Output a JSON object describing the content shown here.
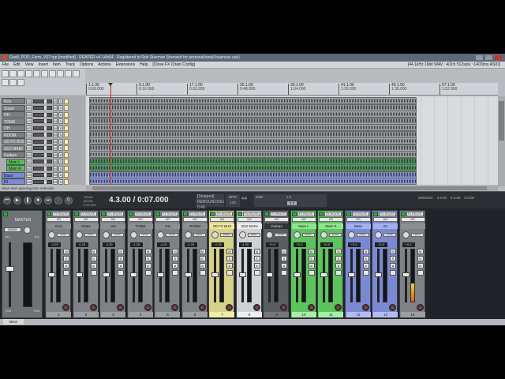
{
  "window": {
    "title": "Grw8_POD_Farm_VST.rpp [modified] - REAPER v4.14/x64 - Registered to Rob Siseman (licensed for personal/small business use)"
  },
  "menu": {
    "items": [
      "File",
      "Edit",
      "View",
      "Insert",
      "Item",
      "Track",
      "Options",
      "Actions",
      "Extensions",
      "Help",
      "[Close FX Chain Config]"
    ],
    "audio_format": "[44.1kHz 16bit WAV : 4/2ch 512spls ~14/29ms ASIO]"
  },
  "ruler": {
    "ticks": [
      {
        "bar": "1.1.00",
        "time": "0:00.000"
      },
      {
        "bar": "9.1.00",
        "time": "0:16.000"
      },
      {
        "bar": "17.1.00",
        "time": "0:32.000"
      },
      {
        "bar": "25.1.00",
        "time": "0:48.000"
      },
      {
        "bar": "33.1.00",
        "time": "1:04.000"
      },
      {
        "bar": "41.1.00",
        "time": "1:20.000"
      },
      {
        "bar": "49.1.00",
        "time": "1:36.000"
      },
      {
        "bar": "57.1.00",
        "time": "1:52.000"
      }
    ]
  },
  "tracks": [
    {
      "name": "Kick",
      "io": "I/O",
      "color": "#7b7f83"
    },
    {
      "name": "Snare",
      "io": "I/O",
      "color": "#7b7f83"
    },
    {
      "name": "HH",
      "io": "I/O",
      "color": "#7b7f83"
    },
    {
      "name": "TOMS",
      "io": "I/O",
      "color": "#7b7f83"
    },
    {
      "name": "OH",
      "io": "I/O",
      "color": "#7b7f83"
    },
    {
      "name": "ROOM",
      "io": "I/O",
      "color": "#7b7f83"
    },
    {
      "name": "SD FX BUS",
      "io": "I/O",
      "color": "#7b7f83"
    },
    {
      "name": "SD2 MAIN",
      "io": "I/O",
      "color": "#7b7f83"
    },
    {
      "name": "Guitars",
      "io": "I/O",
      "color": "#7b7f83"
    },
    {
      "name": "Main L",
      "io": "I/O",
      "color": "#58c058"
    },
    {
      "name": "Main R",
      "io": "I/O",
      "color": "#58c058"
    },
    {
      "name": "Bass",
      "io": "I/O",
      "color": "#7a8ad8"
    },
    {
      "name": "DI",
      "io": "I/O",
      "color": "#7a8ad8"
    }
  ],
  "status_text": "Move item ignoring time selection",
  "transport": {
    "time": "4.3.00 / 0:07.000",
    "state": "[Stopped]",
    "state_sub": "REBOUNCING 0:46",
    "bpm_label": "BPM",
    "bpm": "120",
    "time_sig": "4/4",
    "rate_label": "Rate",
    "rate": "1.0",
    "rate_box": "1.0",
    "selection_label": "Selection",
    "sel_start": "4.4.00",
    "sel_end": "4.4.00",
    "sel_len": "0.0.00",
    "small": "GRAB MODE\n0:00.000"
  },
  "mixer": {
    "master": {
      "label": "MASTER",
      "mono": "MONO",
      "val_l": "-8.1",
      "val_r": "-8.1",
      "bottom_l": "+0.0",
      "bottom_r": "+0.0"
    },
    "strip_io": "I/O",
    "strip_tag": "FX ROUTE",
    "pan_label": "center",
    "btn_m": "M",
    "btn_s": "S",
    "strips": [
      {
        "name": "Kick",
        "num": "1",
        "vol": "-4.25",
        "level": 0.0,
        "style": ""
      },
      {
        "name": "Snare",
        "num": "2",
        "vol": "-4.25",
        "level": 0.0,
        "style": ""
      },
      {
        "name": "HH",
        "num": "3",
        "vol": "-4.25",
        "level": 0.0,
        "style": ""
      },
      {
        "name": "TOMS",
        "num": "4",
        "vol": "-4.25",
        "level": 0.0,
        "style": ""
      },
      {
        "name": "OH",
        "num": "5",
        "vol": "-4.25",
        "level": 0.0,
        "style": ""
      },
      {
        "name": "ROOM",
        "num": "6",
        "vol": "-4.25",
        "level": 0.0,
        "style": ""
      },
      {
        "name": "SD FX BUS",
        "num": "7",
        "vol": "-4.25",
        "level": 0.0,
        "style": "yellow"
      },
      {
        "name": "SD2 MAIN",
        "num": "8",
        "vol": "-4.25",
        "level": 0.0,
        "style": "white"
      },
      {
        "name": "Guitars",
        "num": "9",
        "vol": "+0.0",
        "level": 0.0,
        "style": "dark"
      },
      {
        "name": "Main L",
        "num": "10",
        "vol": "+0.0",
        "level": 0.0,
        "style": "green"
      },
      {
        "name": "Main R",
        "num": "11",
        "vol": "+0.0",
        "level": 0.0,
        "style": "green"
      },
      {
        "name": "Bass",
        "num": "12",
        "vol": "+0.0",
        "level": 0.0,
        "style": "blue"
      },
      {
        "name": "DI",
        "num": "13",
        "vol": "+0.0",
        "level": 0.0,
        "style": "blue"
      },
      {
        "name": "",
        "num": "14",
        "vol": "+0.0",
        "level": 0.35,
        "style": ""
      }
    ],
    "tab_label": "Mixer"
  }
}
